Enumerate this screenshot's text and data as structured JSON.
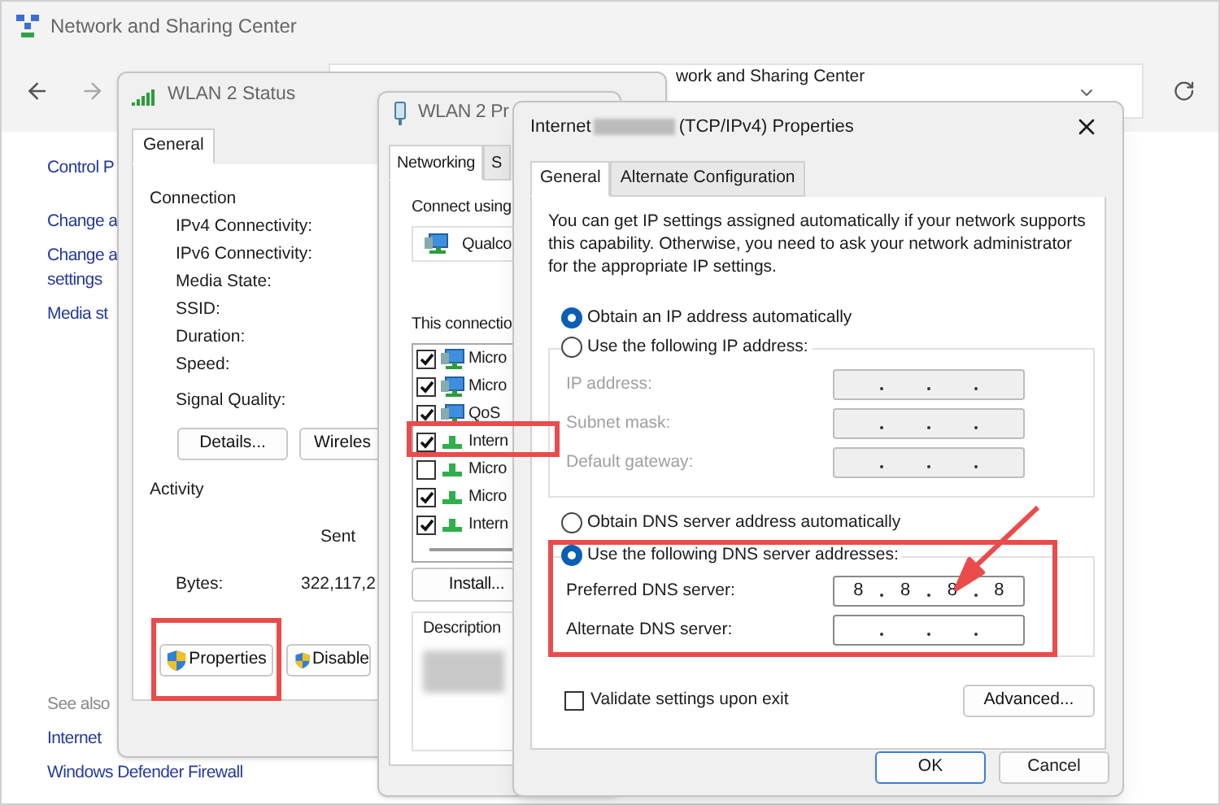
{
  "background_window": {
    "title": "Network and Sharing Center",
    "address": "work and Sharing Center",
    "control_panel_link": "Control P",
    "task_links": [
      [
        "Change a"
      ],
      [
        "Change a",
        "settings"
      ],
      [
        "Media st"
      ]
    ],
    "see_also": {
      "heading": "See also",
      "links": [
        "Internet",
        "Windows Defender Firewall"
      ]
    }
  },
  "status_window": {
    "title": "WLAN 2 Status",
    "tabs": [
      {
        "label": "General",
        "selected": true
      }
    ],
    "connection_heading": "Connection",
    "connection_labels": [
      "IPv4 Connectivity:",
      "IPv6 Connectivity:",
      "Media State:",
      "SSID:",
      "Duration:",
      "Speed:"
    ],
    "signal_label": "Signal Quality:",
    "buttons": [
      "Details...",
      "Wireles"
    ],
    "activity_heading": "Activity",
    "sent_label": "Sent",
    "bytes_label": "Bytes:",
    "bytes_sent": "322,117,2",
    "action_buttons": [
      "Properties",
      "Disable"
    ]
  },
  "properties_window": {
    "title": "WLAN 2 Pr",
    "tabs": [
      {
        "label": "Networking",
        "selected": true
      },
      {
        "label": "S",
        "selected": false
      }
    ],
    "connect_using": "Connect using",
    "adapter": "Qualco",
    "items_heading": "This connectio",
    "items": [
      {
        "label": "Micro",
        "checked": true,
        "kind": "client"
      },
      {
        "label": "Micro",
        "checked": true,
        "kind": "client"
      },
      {
        "label": "QoS",
        "checked": true,
        "kind": "client"
      },
      {
        "label": "Intern",
        "checked": true,
        "kind": "protocol"
      },
      {
        "label": "Micro",
        "checked": false,
        "kind": "protocol"
      },
      {
        "label": "Micro",
        "checked": true,
        "kind": "protocol"
      },
      {
        "label": "Intern",
        "checked": true,
        "kind": "protocol"
      }
    ],
    "install_button": "Install...",
    "description_heading": "Description"
  },
  "ipv4_window": {
    "title_start": "Internet",
    "title_end": "(TCP/IPv4) Properties",
    "tabs": [
      {
        "label": "General",
        "selected": true
      },
      {
        "label": "Alternate Configuration",
        "selected": false
      }
    ],
    "intro": "You can get IP settings assigned automatically if your network supports this capability. Otherwise, you need to ask your network administrator for the appropriate IP settings.",
    "ip_options": [
      {
        "label": "Obtain an IP address automatically",
        "selected": true
      },
      {
        "label": "Use the following IP address:",
        "selected": false
      }
    ],
    "ip_fields": [
      {
        "label": "IP address:",
        "disabled": true
      },
      {
        "label": "Subnet mask:",
        "disabled": true
      },
      {
        "label": "Default gateway:",
        "disabled": true
      }
    ],
    "dns_options": [
      {
        "label": "Obtain DNS server address automatically",
        "selected": false
      },
      {
        "label": "Use the following DNS server addresses:",
        "selected": true
      }
    ],
    "dns_fields": [
      {
        "label": "Preferred DNS server:",
        "disabled": false,
        "octets": [
          "8",
          "8",
          "8",
          "8"
        ]
      },
      {
        "label": "Alternate DNS server:",
        "disabled": false
      }
    ],
    "validate": {
      "label": "Validate settings upon exit",
      "checked": false
    },
    "advanced_button": "Advanced...",
    "buttons": [
      {
        "label": "OK",
        "default": true
      },
      {
        "label": "Cancel",
        "default": false
      }
    ]
  }
}
